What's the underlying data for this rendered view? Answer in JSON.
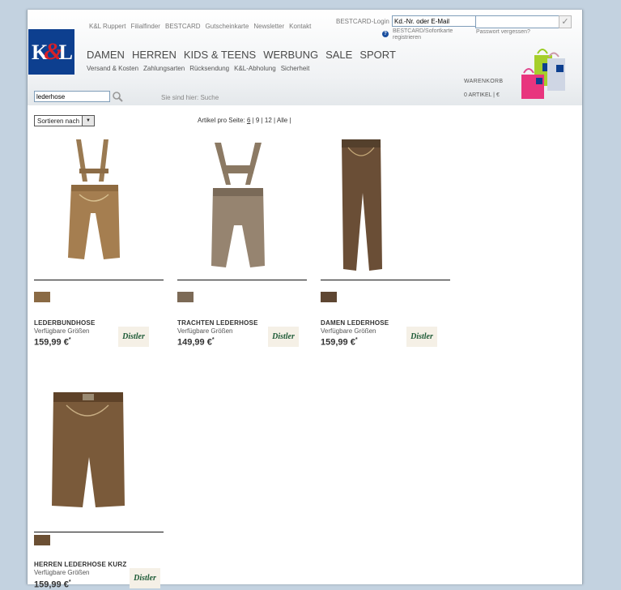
{
  "header": {
    "logo_text": "K&L",
    "top_links": [
      "K&L Ruppert",
      "Filialfinder",
      "BESTCARD",
      "Gutscheinkarte",
      "Newsletter",
      "Kontakt"
    ],
    "login_label": "BESTCARD-Login",
    "login_placeholder": "Kd.-Nr. oder E-Mail",
    "register_text": "BESTCARD/Sofortkarte registrieren",
    "password_forgot": "Passwort vergessen?",
    "main_nav": [
      "DAMEN",
      "HERREN",
      "KIDS & TEENS",
      "WERBUNG",
      "SALE",
      "SPORT"
    ],
    "sub_nav": [
      "Versand & Kosten",
      "Zahlungsarten",
      "Rücksendung",
      "K&L-Abholung",
      "Sicherheit"
    ],
    "cart_label": "WARENKORB",
    "cart_status": "0 ARTIKEL | €"
  },
  "search": {
    "value": "lederhose",
    "breadcrumb": "Sie sind hier: Suche"
  },
  "toolbar": {
    "sort_label": "Sortieren nach",
    "perpage_label": "Artikel pro Seite:",
    "perpage_options": [
      "6",
      "9",
      "12",
      "Alle"
    ]
  },
  "products": [
    {
      "name": "LEDERBUNDHOSE",
      "sizes": "Verfügbare Größen",
      "price": "159,99 €",
      "price_mark": "*",
      "brand": "Distler",
      "swatch_color": "#8a6a44"
    },
    {
      "name": "TRACHTEN LEDERHOSE",
      "sizes": "Verfügbare Größen",
      "price": "149,99 €",
      "price_mark": "*",
      "brand": "Distler",
      "swatch_color": "#7c6a56"
    },
    {
      "name": "DAMEN LEDERHOSE",
      "sizes": "Verfügbare Größen",
      "price": "159,99 €",
      "price_mark": "*",
      "brand": "Distler",
      "swatch_color": "#5e4632"
    },
    {
      "name": "HERREN LEDERHOSE KURZ",
      "sizes": "Verfügbare Größen",
      "price": "159,99 €",
      "price_mark": "*",
      "brand": "Distler",
      "swatch_color": "#6b4f33"
    }
  ],
  "colors": {
    "logo_blue": "#0d3f8f",
    "logo_red": "#d82027",
    "background": "#c3d2e0"
  }
}
